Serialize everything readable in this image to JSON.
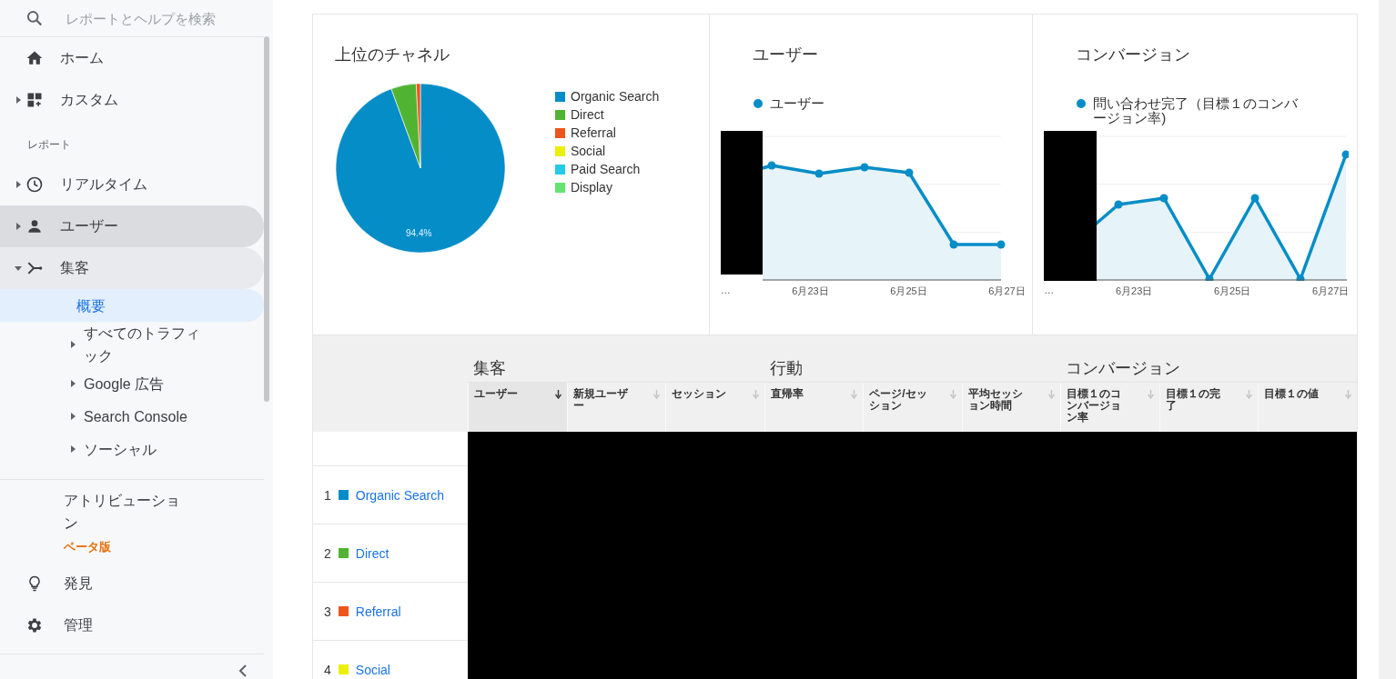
{
  "sidebar": {
    "search": {
      "placeholder": "レポートとヘルプを検索"
    },
    "items": [
      {
        "kind": "item",
        "label": "ホーム",
        "hovered": false
      },
      {
        "kind": "item",
        "label": "カスタム",
        "expanded": false,
        "hovered": false
      },
      {
        "kind": "section",
        "label": "レポート"
      },
      {
        "kind": "item",
        "label": "リアルタイム",
        "expanded": false,
        "hovered": false
      },
      {
        "kind": "item",
        "label": "ユーザー",
        "expanded": false,
        "hovered": true
      },
      {
        "kind": "item",
        "label": "集客",
        "expanded": true,
        "hovered": false,
        "children": [
          {
            "label": "概要",
            "selected": true
          },
          {
            "label": "すべてのトラフィック",
            "expanded": false,
            "selected": false
          },
          {
            "label": "Google 広告",
            "expanded": false,
            "selected": false
          },
          {
            "label": "Search Console",
            "expanded": false,
            "selected": false
          },
          {
            "label": "ソーシャル",
            "expanded": false,
            "selected": false
          }
        ]
      }
    ],
    "footer_items": [
      {
        "kind": "badge",
        "label": "アトリビューション",
        "badge": "ベータ版"
      },
      {
        "kind": "item",
        "label": "発見"
      },
      {
        "kind": "item",
        "label": "管理"
      }
    ]
  },
  "channels_card": {
    "title": "上位のチャネル",
    "slice_label": "94.4%",
    "legend": [
      {
        "label": "Organic Search",
        "color": "#058dc7"
      },
      {
        "label": "Direct",
        "color": "#50b432"
      },
      {
        "label": "Referral",
        "color": "#ed561b"
      },
      {
        "label": "Social",
        "color": "#edef00"
      },
      {
        "label": "Paid Search",
        "color": "#24cbe5"
      },
      {
        "label": "Display",
        "color": "#64e572"
      }
    ]
  },
  "line_cards": [
    {
      "title": "ユーザー",
      "series_label": "ユーザー",
      "x_labels": [
        "…",
        "6月23日",
        "6月25日",
        "6月27日"
      ]
    },
    {
      "title": "コンバージョン",
      "series_label": "問い合わせ完了（目標１のコンバージョン率)",
      "x_labels": [
        "…",
        "6月23日",
        "6月25日",
        "6月27日"
      ]
    }
  ],
  "table": {
    "groups": [
      "集客",
      "行動",
      "コンバージョン"
    ],
    "columns": [
      {
        "label": "ユーザー",
        "sorted": true
      },
      {
        "label": "新規ユーザー",
        "sorted": false
      },
      {
        "label": "セッション",
        "sorted": false
      },
      {
        "label": "直帰率",
        "sorted": false
      },
      {
        "label": "ページ/セッション",
        "sorted": false
      },
      {
        "label": "平均セッション時間",
        "sorted": false
      },
      {
        "label": "目標１のコンバージョン率",
        "sorted": false
      },
      {
        "label": "目標１の完了",
        "sorted": false
      },
      {
        "label": "目標１の値",
        "sorted": false
      }
    ],
    "rows": [
      {
        "rank": "1",
        "channel": "Organic Search",
        "color": "#058dc7"
      },
      {
        "rank": "2",
        "channel": "Direct",
        "color": "#50b432"
      },
      {
        "rank": "3",
        "channel": "Referral",
        "color": "#ed561b"
      },
      {
        "rank": "4",
        "channel": "Social",
        "color": "#edef00"
      }
    ]
  }
}
